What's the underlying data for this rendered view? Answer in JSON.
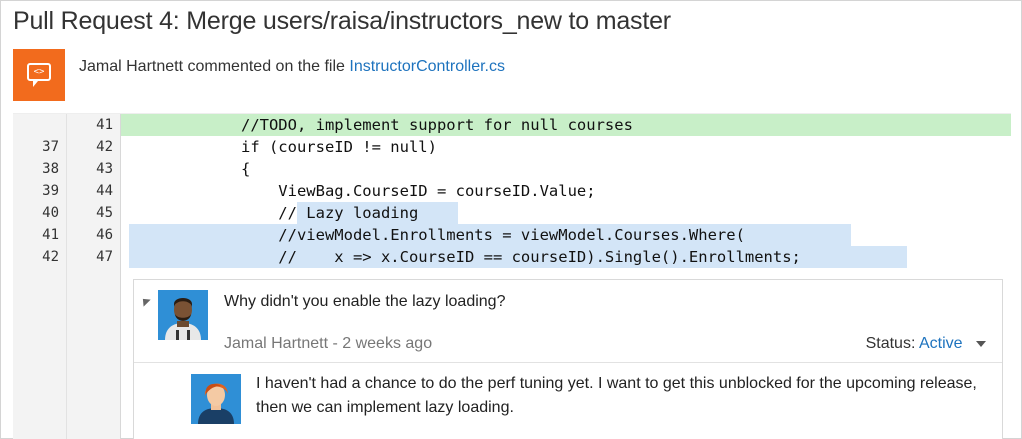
{
  "pull_request": {
    "title": "Pull Request 4: Merge users/raisa/instructors_new to master"
  },
  "activity": {
    "author": "Jamal Hartnett",
    "action_text": "commented on the file",
    "file_name": "InstructorController.cs"
  },
  "code": {
    "lines": [
      {
        "old": "",
        "new": "41",
        "text": "            //TODO, implement support for null courses"
      },
      {
        "old": "37",
        "new": "42",
        "text": "            if (courseID != null)"
      },
      {
        "old": "38",
        "new": "43",
        "text": "            {"
      },
      {
        "old": "39",
        "new": "44",
        "text": "                ViewBag.CourseID = courseID.Value;"
      },
      {
        "old": "40",
        "new": "45",
        "text": "                // Lazy loading"
      },
      {
        "old": "41",
        "new": "46",
        "text": "                //viewModel.Enrollments = viewModel.Courses.Where("
      },
      {
        "old": "42",
        "new": "47",
        "text": "                //    x => x.CourseID == courseID).Single().Enrollments;"
      }
    ]
  },
  "thread": {
    "question": "Why didn't you enable the lazy loading?",
    "meta": "Jamal Hartnett - 2 weeks ago",
    "status_label": "Status:",
    "status_value": "Active",
    "reply": "I haven't had a chance to do the perf tuning yet.  I want to get this unblocked for the upcoming release, then we can implement lazy loading."
  },
  "colors": {
    "accent": "#1e73be",
    "added_line": "#c8efc8",
    "selection": "#d3e5f7",
    "activity_icon": "#f26b1d"
  },
  "icons": {
    "activity": "code-comment-icon",
    "collapse": "collapse-caret-icon",
    "status_dropdown": "chevron-down-icon"
  }
}
